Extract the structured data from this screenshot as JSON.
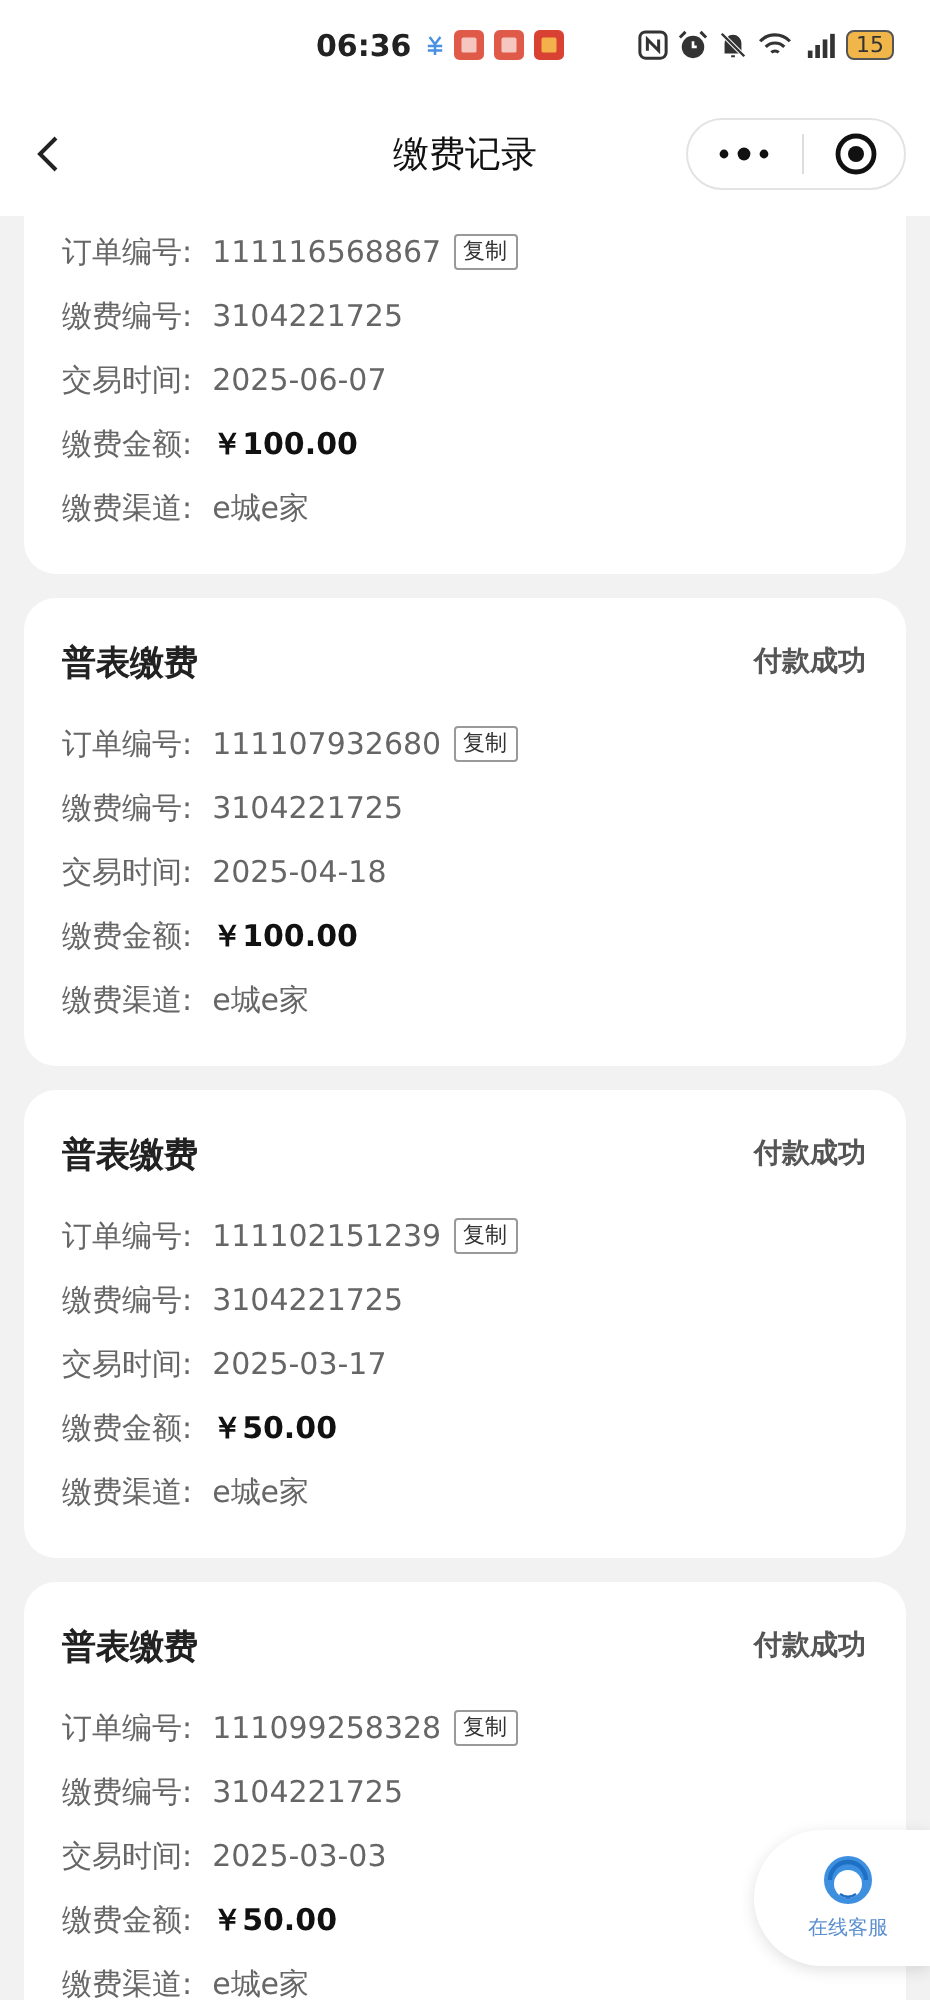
{
  "status_bar": {
    "time": "06:36",
    "battery": "15"
  },
  "header": {
    "title": "缴费记录"
  },
  "records": [
    {
      "order_label": "订单编号:",
      "order_no": "111116568867",
      "copy": "复制",
      "fields": [
        {
          "label": "缴费编号:",
          "value": "3104221725",
          "kind": "plain"
        },
        {
          "label": "交易时间:",
          "value": "2025-06-07",
          "kind": "plain"
        },
        {
          "label": "缴费金额:",
          "value": "￥100.00",
          "kind": "amount"
        },
        {
          "label": "缴费渠道:",
          "value": "e城e家",
          "kind": "plain"
        }
      ]
    },
    {
      "title": "普表缴费",
      "status": "付款成功",
      "order_label": "订单编号:",
      "order_no": "111107932680",
      "copy": "复制",
      "fields": [
        {
          "label": "缴费编号:",
          "value": "3104221725",
          "kind": "plain"
        },
        {
          "label": "交易时间:",
          "value": "2025-04-18",
          "kind": "plain"
        },
        {
          "label": "缴费金额:",
          "value": "￥100.00",
          "kind": "amount"
        },
        {
          "label": "缴费渠道:",
          "value": "e城e家",
          "kind": "plain"
        }
      ]
    },
    {
      "title": "普表缴费",
      "status": "付款成功",
      "order_label": "订单编号:",
      "order_no": "111102151239",
      "copy": "复制",
      "fields": [
        {
          "label": "缴费编号:",
          "value": "3104221725",
          "kind": "plain"
        },
        {
          "label": "交易时间:",
          "value": "2025-03-17",
          "kind": "plain"
        },
        {
          "label": "缴费金额:",
          "value": "￥50.00",
          "kind": "amount"
        },
        {
          "label": "缴费渠道:",
          "value": "e城e家",
          "kind": "plain"
        }
      ]
    },
    {
      "title": "普表缴费",
      "status": "付款成功",
      "order_label": "订单编号:",
      "order_no": "111099258328",
      "copy": "复制",
      "fields": [
        {
          "label": "缴费编号:",
          "value": "3104221725",
          "kind": "plain"
        },
        {
          "label": "交易时间:",
          "value": "2025-03-03",
          "kind": "plain"
        },
        {
          "label": "缴费金额:",
          "value": "￥50.00",
          "kind": "amount"
        },
        {
          "label": "缴费渠道:",
          "value": "e城e家",
          "kind": "plain"
        }
      ]
    }
  ],
  "service_button": {
    "label": "在线客服"
  }
}
